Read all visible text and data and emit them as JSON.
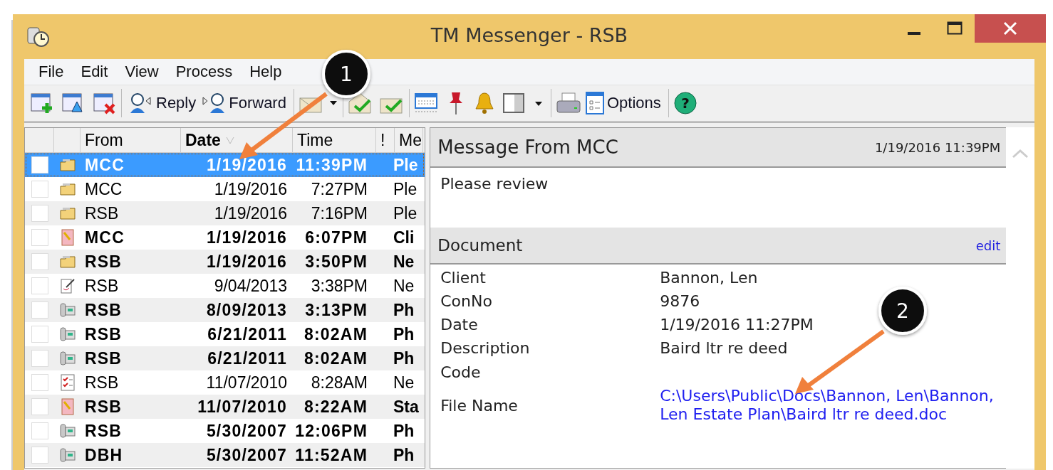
{
  "window": {
    "title": "TM Messenger - RSB"
  },
  "menu": [
    {
      "label": "File"
    },
    {
      "label": "Edit"
    },
    {
      "label": "View"
    },
    {
      "label": "Process"
    },
    {
      "label": "Help"
    }
  ],
  "toolbar": {
    "reply": "Reply",
    "forward": "Forward",
    "options": "Options",
    "help": "?"
  },
  "list": {
    "columns": [
      {
        "label": "From",
        "sorted": false
      },
      {
        "label": "Date",
        "sorted": true
      },
      {
        "label": "Time",
        "sorted": false
      },
      {
        "label": "!",
        "sorted": false
      },
      {
        "label": "Me",
        "sorted": false
      }
    ],
    "rows": [
      {
        "kind": "folder",
        "from": "MCC",
        "date": "1/19/2016",
        "time": "11:39PM",
        "column_5": "Ple",
        "unread": true,
        "selected": true
      },
      {
        "kind": "folder",
        "from": "MCC",
        "date": "1/19/2016",
        "time": "7:27PM",
        "column_5": "Ple",
        "unread": false,
        "selected": false
      },
      {
        "kind": "folder",
        "from": "RSB",
        "date": "1/19/2016",
        "time": "7:16PM",
        "column_5": "Ple",
        "unread": false,
        "selected": false
      },
      {
        "kind": "note",
        "from": "MCC",
        "date": "1/19/2016",
        "time": "6:07PM",
        "column_5": "Cli",
        "unread": true,
        "selected": false
      },
      {
        "kind": "folder",
        "from": "RSB",
        "date": "1/19/2016",
        "time": "3:50PM",
        "column_5": "Ne",
        "unread": true,
        "selected": false
      },
      {
        "kind": "edit",
        "from": "RSB",
        "date": "9/04/2013",
        "time": "3:38PM",
        "column_5": "Ne",
        "unread": false,
        "selected": false
      },
      {
        "kind": "phone",
        "from": "RSB",
        "date": "8/09/2013",
        "time": "3:13PM",
        "column_5": "Ph",
        "unread": true,
        "selected": false
      },
      {
        "kind": "phone",
        "from": "RSB",
        "date": "6/21/2011",
        "time": "8:02AM",
        "column_5": "Ph",
        "unread": true,
        "selected": false
      },
      {
        "kind": "phone",
        "from": "RSB",
        "date": "6/21/2011",
        "time": "8:02AM",
        "column_5": "Ph",
        "unread": true,
        "selected": false
      },
      {
        "kind": "checklist",
        "from": "RSB",
        "date": "11/07/2010",
        "time": "8:28AM",
        "column_5": "Ne",
        "unread": false,
        "selected": false
      },
      {
        "kind": "note",
        "from": "RSB",
        "date": "11/07/2010",
        "time": "8:22AM",
        "column_5": "Sta",
        "unread": true,
        "selected": false
      },
      {
        "kind": "phone",
        "from": "RSB",
        "date": "5/30/2007",
        "time": "12:06PM",
        "column_5": "Ph",
        "unread": true,
        "selected": false
      },
      {
        "kind": "phone",
        "from": "DBH",
        "date": "5/30/2007",
        "time": "11:52AM",
        "column_5": "Ph",
        "unread": true,
        "selected": false
      }
    ]
  },
  "detail": {
    "title": "Message From MCC",
    "timestamp": "1/19/2016 11:39PM",
    "body": "Please review",
    "section": {
      "title": "Document",
      "edit": "edit",
      "fields": [
        {
          "label": "Client",
          "value": "Bannon, Len",
          "kind": "text"
        },
        {
          "label": "ConNo",
          "value": "9876",
          "kind": "text"
        },
        {
          "label": "Date",
          "value": "1/19/2016 11:27PM",
          "kind": "text"
        },
        {
          "label": "Description",
          "value": "Baird ltr re deed",
          "kind": "text"
        },
        {
          "label": "Code",
          "kind": "text"
        },
        {
          "label": "File Name",
          "value": "C:\\Users\\Public\\Docs\\Bannon, Len\\Bannon, Len Estate Plan\\Baird ltr re deed.doc",
          "kind": "link"
        }
      ]
    }
  },
  "callouts": [
    {
      "number": "1"
    },
    {
      "number": "2"
    }
  ]
}
